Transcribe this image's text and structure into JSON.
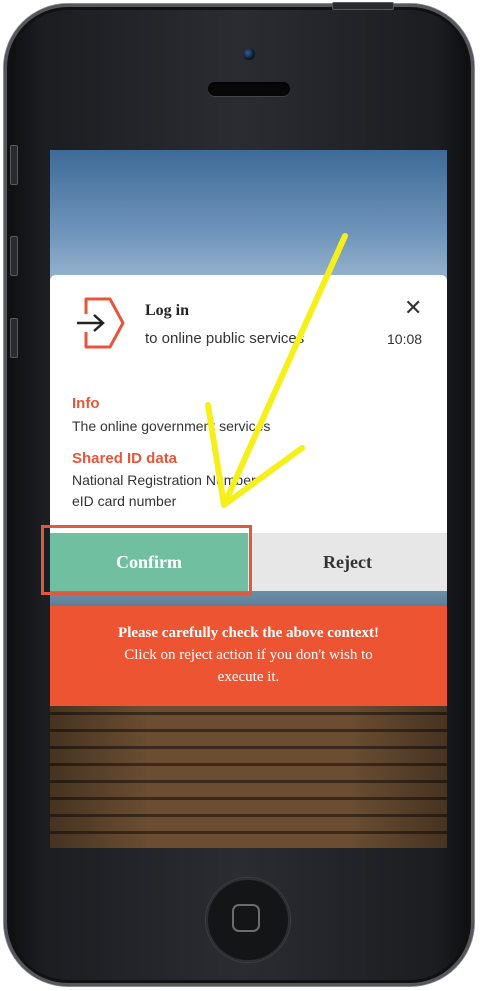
{
  "notification": {
    "title": "Log in",
    "subtitle": "to online public services",
    "time": "10:08",
    "close_symbol": "✕",
    "icon": "login-arrow-icon"
  },
  "sections": {
    "info_title": "Info",
    "info_text": "The online government services",
    "shared_title": "Shared ID data",
    "shared_items": [
      "National Registration Number",
      "eID card number"
    ]
  },
  "actions": {
    "confirm_label": "Confirm",
    "reject_label": "Reject"
  },
  "warning": {
    "line1": "Please carefully check the above context!",
    "line2": "Click on reject action if you don't wish to",
    "line3": "execute it."
  },
  "colors": {
    "accent": "#e8553a",
    "confirm": "#6fbfa0",
    "reject_bg": "#e7e7e7",
    "warning_bg": "#ec5432",
    "annotation_arrow": "#f5ef1a",
    "highlight_box": "#de5a3c"
  }
}
